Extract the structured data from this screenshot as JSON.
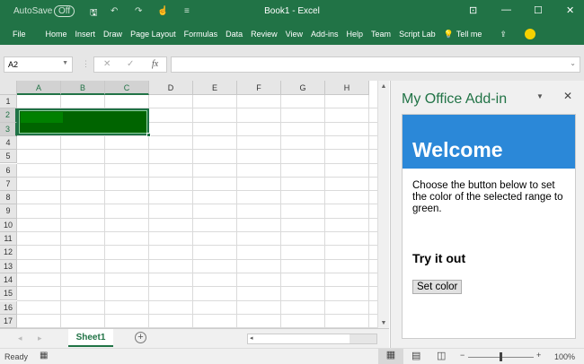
{
  "title_bar": {
    "autosave": "AutoSave",
    "autosave_state": "Off",
    "title": "Book1  -  Excel"
  },
  "ribbon": {
    "tabs": [
      "File",
      "Home",
      "Insert",
      "Draw",
      "Page Layout",
      "Formulas",
      "Data",
      "Review",
      "View",
      "Add-ins",
      "Help",
      "Team",
      "Script Lab"
    ],
    "tell_me": "Tell me"
  },
  "formula_bar": {
    "name_box": "A2",
    "fx": "fx",
    "formula": ""
  },
  "grid": {
    "columns": [
      "A",
      "B",
      "C",
      "D",
      "E",
      "F",
      "G",
      "H"
    ],
    "rows": [
      "1",
      "2",
      "3",
      "4",
      "5",
      "6",
      "7",
      "8",
      "9",
      "10",
      "11",
      "12",
      "13",
      "14",
      "15",
      "16",
      "17"
    ],
    "selected_fill": "#006400"
  },
  "sheet_tabs": {
    "active": "Sheet1"
  },
  "status_bar": {
    "status": "Ready",
    "zoom": "100%"
  },
  "task_pane": {
    "title": "My Office Add-in",
    "header": "Welcome",
    "description": "Choose the button below to set the color of the selected range to green.",
    "section": "Try it out",
    "button": "Set color"
  }
}
